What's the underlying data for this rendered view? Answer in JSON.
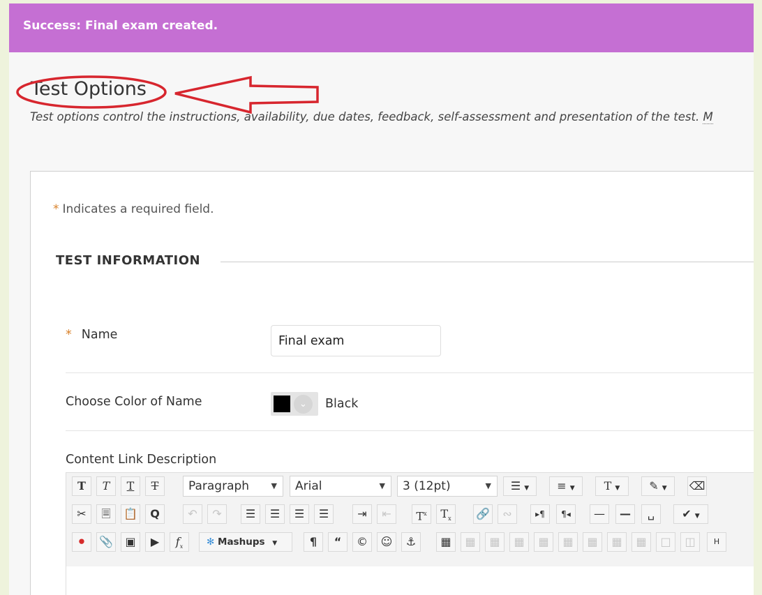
{
  "banner": {
    "message": "Success: Final exam created."
  },
  "page": {
    "title": "Test Options",
    "description_main": "Test options control the instructions, availability, due dates, feedback, self-assessment and presentation of the test. ",
    "description_more": "M"
  },
  "form": {
    "required_note": "Indicates a required field.",
    "required_star": "*",
    "section_title": "TEST INFORMATION",
    "name": {
      "label": "Name",
      "value": "Final exam"
    },
    "color": {
      "label": "Choose Color of Name",
      "value": "Black",
      "swatch": "#000000"
    },
    "content_link": {
      "label": "Content Link Description"
    }
  },
  "toolbar": {
    "row1": {
      "format_label": "Paragraph",
      "font_label": "Arial",
      "size_label": "3 (12pt)"
    },
    "row3": {
      "mashups_label": "Mashups"
    }
  },
  "colors": {
    "banner": "#c56fd3",
    "annotation": "#d7262e",
    "required": "#d9822b"
  }
}
